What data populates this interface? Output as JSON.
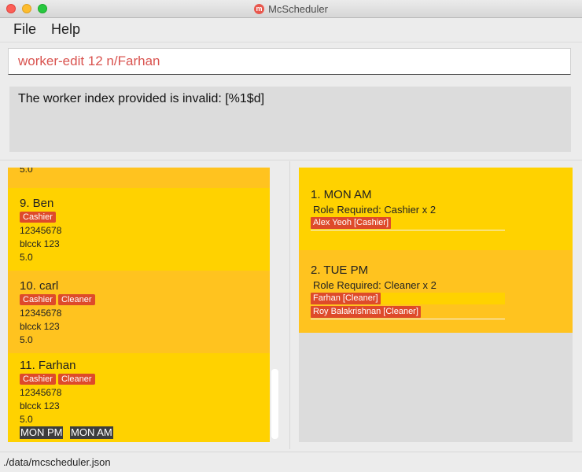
{
  "window": {
    "title": "McScheduler",
    "app_icon_glyph": "m"
  },
  "menu": {
    "file": "File",
    "help": "Help"
  },
  "command": {
    "text": "worker-edit 12 n/Farhan"
  },
  "result": {
    "text": "The worker index provided is invalid: [%1$d]"
  },
  "workers": [
    {
      "lines": [
        "5.0"
      ]
    },
    {
      "name": "9.  Ben",
      "roles": [
        "Cashier"
      ],
      "phone": "12345678",
      "address": "blcck 123",
      "pay": "5.0"
    },
    {
      "name": "10.  carl",
      "roles": [
        "Cashier",
        "Cleaner"
      ],
      "phone": "12345678",
      "address": "blcck 123",
      "pay": "5.0"
    },
    {
      "name": "11.  Farhan",
      "roles": [
        "Cashier",
        "Cleaner"
      ],
      "phone": "12345678",
      "address": "blcck 123",
      "pay": "5.0",
      "availability": [
        "MON PM",
        "MON AM"
      ]
    }
  ],
  "shifts": [
    {
      "title": "1.  MON AM",
      "role": "Role Required: Cashier x 2",
      "assigned": [
        "Alex Yeoh [Cashier]"
      ]
    },
    {
      "title": "2.  TUE PM",
      "role": "Role Required: Cleaner x 2",
      "assigned": [
        "Farhan [Cleaner]",
        "Roy Balakrishnan [Cleaner]"
      ]
    }
  ],
  "status": {
    "path": "./data/mcscheduler.json"
  },
  "colors": {
    "card_yellow": "#ffd200",
    "card_amber": "#ffc31f",
    "tag_red": "#de4a2a",
    "command_text": "#d9534f"
  }
}
